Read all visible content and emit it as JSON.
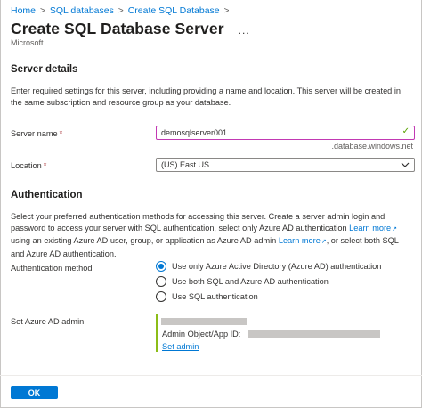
{
  "breadcrumb": {
    "items": [
      "Home",
      "SQL databases",
      "Create SQL Database"
    ],
    "separator": ">"
  },
  "header": {
    "title": "Create SQL Database Server",
    "more": "...",
    "publisher": "Microsoft"
  },
  "server_details": {
    "heading": "Server details",
    "description": "Enter required settings for this server, including providing a name and location. This server will be created in the same subscription and resource group as your database.",
    "server_name": {
      "label": "Server name",
      "required": "*",
      "value": "demosqlserver001",
      "suffix": ".database.windows.net",
      "valid_icon": "check-icon"
    },
    "location": {
      "label": "Location",
      "required": "*",
      "value": "(US) East US",
      "icon": "chevron-down-icon"
    }
  },
  "authentication": {
    "heading": "Authentication",
    "description_part1": "Select your preferred authentication methods for accessing this server. Create a server admin login and password to access your server with SQL authentication, select only Azure AD authentication",
    "learn_more_1": "Learn more",
    "description_part2": "using an existing Azure AD user, group, or application as Azure AD admin",
    "learn_more_2": "Learn more",
    "description_part3": ", or select both SQL and Azure AD authentication.",
    "method_label": "Authentication method",
    "options": [
      {
        "label": "Use only Azure Active Directory (Azure AD) authentication",
        "checked": true
      },
      {
        "label": "Use both SQL and Azure AD authentication",
        "checked": false
      },
      {
        "label": "Use SQL authentication",
        "checked": false
      }
    ],
    "admin_label": "Set Azure AD admin",
    "admin_object_label": "Admin Object/App ID:",
    "set_admin_link": "Set admin"
  },
  "footer": {
    "ok_label": "OK"
  },
  "colors": {
    "accent": "#0078d4",
    "valid": "#57a300",
    "required": "#a4262c",
    "focus_border": "#c239b3",
    "admin_border": "#8cbd18"
  }
}
